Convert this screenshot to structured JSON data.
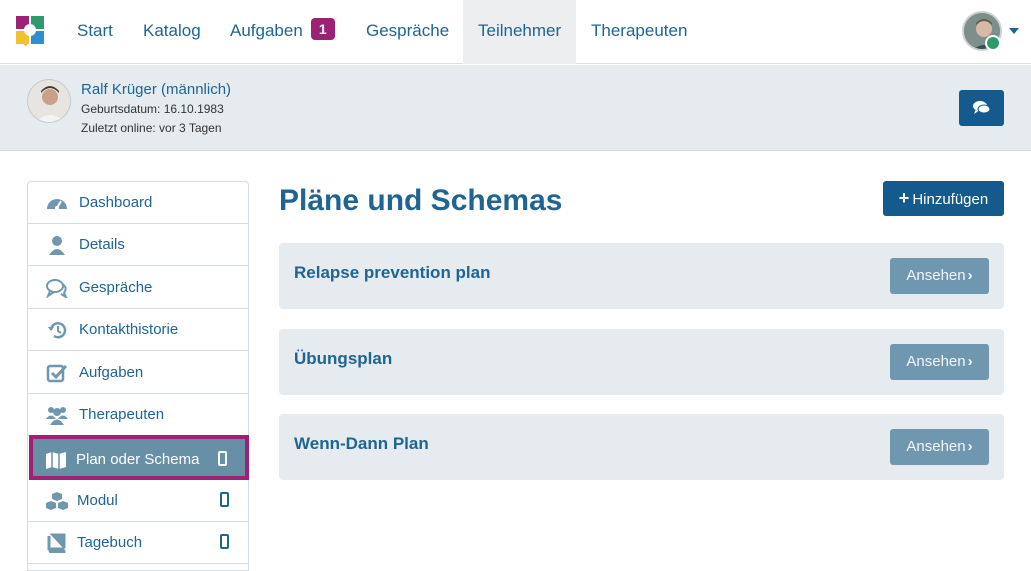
{
  "topnav": {
    "items": [
      {
        "label": "Start"
      },
      {
        "label": "Katalog"
      },
      {
        "label": "Aufgaben",
        "badge": "1"
      },
      {
        "label": "Gespräche"
      },
      {
        "label": "Teilnehmer",
        "active": true
      },
      {
        "label": "Therapeuten"
      }
    ],
    "accent_color": "#1f6493",
    "badge_color": "#9c2275"
  },
  "participant": {
    "name": "Ralf Krüger (männlich)",
    "birthdate": "Geburtsdatum: 16.10.1983",
    "last_online": "Zuletzt online: vor 3 Tagen"
  },
  "sidebar": {
    "items": [
      {
        "label": "Dashboard",
        "icon": "dashboard-icon"
      },
      {
        "label": "Details",
        "icon": "user-icon"
      },
      {
        "label": "Gespräche",
        "icon": "comments-icon"
      },
      {
        "label": "Kontakthistorie",
        "icon": "history-icon"
      },
      {
        "label": "Aufgaben",
        "icon": "check-square-icon"
      },
      {
        "label": "Therapeuten",
        "icon": "users-icon"
      },
      {
        "label": "Plan oder Schema",
        "icon": "map-icon",
        "active": true,
        "mobile": true
      },
      {
        "label": "Modul",
        "icon": "cubes-icon",
        "mobile": true
      },
      {
        "label": "Tagebuch",
        "icon": "book-icon",
        "mobile": true
      }
    ]
  },
  "main": {
    "title": "Pläne und Schemas",
    "add_label": "Hinzufügen",
    "plans": [
      {
        "title": "Relapse prevention plan",
        "action": "Ansehen"
      },
      {
        "title": "Übungsplan",
        "action": "Ansehen"
      },
      {
        "title": "Wenn-Dann Plan",
        "action": "Ansehen"
      }
    ]
  }
}
